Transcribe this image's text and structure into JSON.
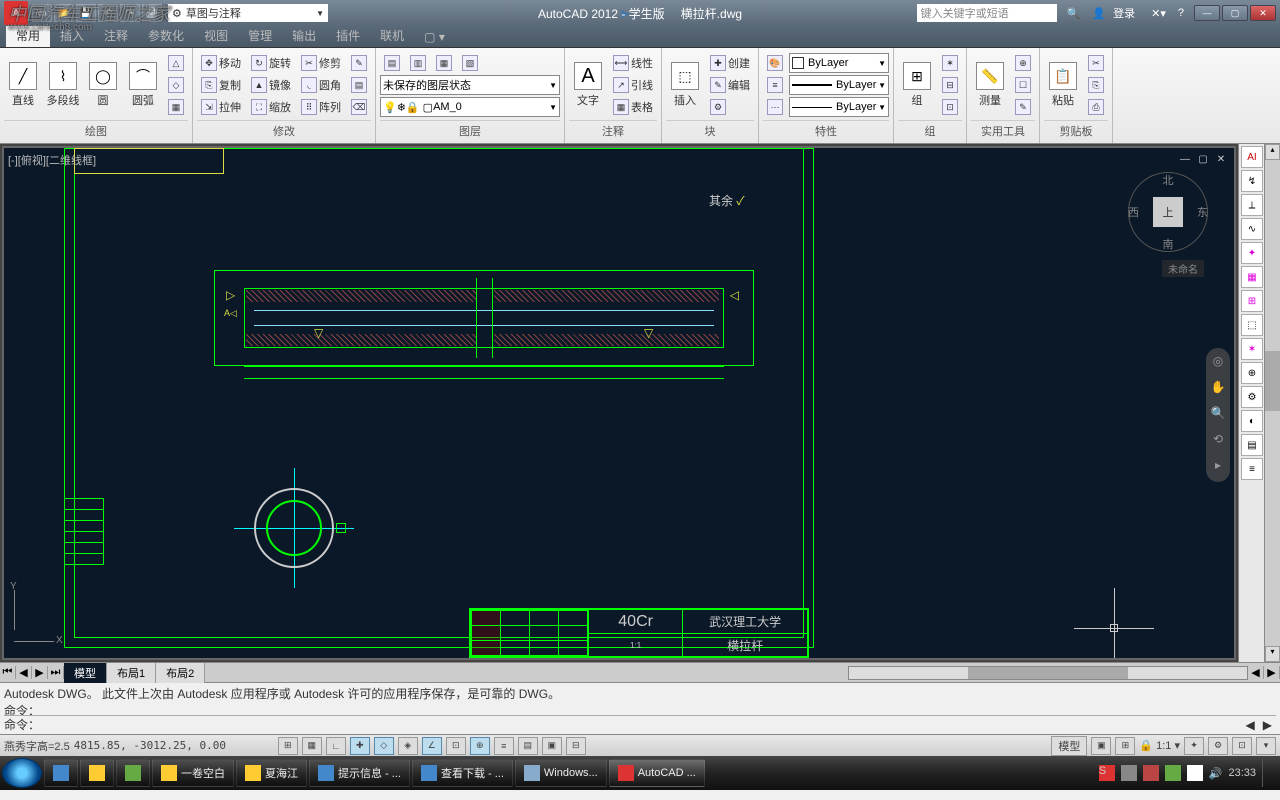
{
  "watermark": {
    "line1": "中国汽车工程师之家",
    "line2": "www.cartech8.com"
  },
  "titlebar": {
    "app": "AutoCAD 2012 - 学生版",
    "doc": "横拉杆.dwg",
    "workspace": "草图与注释",
    "search_placeholder": "键入关键字或短语",
    "login": "登录"
  },
  "tabs": [
    "常用",
    "插入",
    "注释",
    "参数化",
    "视图",
    "管理",
    "输出",
    "插件",
    "联机"
  ],
  "tabs_active": 0,
  "ribbon": {
    "draw": {
      "title": "绘图",
      "btns": [
        "直线",
        "多段线",
        "圆",
        "圆弧"
      ]
    },
    "modify": {
      "title": "修改",
      "rows": [
        [
          "移动",
          "旋转",
          "修剪"
        ],
        [
          "复制",
          "镜像",
          "圆角"
        ],
        [
          "拉伸",
          "缩放",
          "阵列"
        ]
      ]
    },
    "layers": {
      "title": "图层",
      "state": "未保存的图层状态",
      "current": "AM_0"
    },
    "annot": {
      "title": "注释",
      "text": "文字",
      "rows": [
        "线性",
        "引线",
        "表格"
      ]
    },
    "block": {
      "title": "块",
      "insert": "插入",
      "rows": [
        "创建",
        "编辑"
      ]
    },
    "props": {
      "title": "特性",
      "v1": "ByLayer",
      "v2": "ByLayer",
      "v3": "ByLayer"
    },
    "group": {
      "title": "组",
      "btn": "组"
    },
    "util": {
      "title": "实用工具",
      "btn": "测量"
    },
    "clip": {
      "title": "剪贴板",
      "btn": "粘贴"
    }
  },
  "viewport": {
    "label": "[-][俯视][二维线框]",
    "viewcube": {
      "face": "上",
      "n": "北",
      "s": "南",
      "e": "东",
      "w": "西"
    },
    "wcs": "未命名",
    "annotation_other": "其余",
    "ucs": {
      "x": "X",
      "y": "Y"
    }
  },
  "titleblock": {
    "material": "40Cr",
    "school": "武汉理工大学",
    "part": "横拉杆",
    "scale": "1:1"
  },
  "layout_tabs": [
    "模型",
    "布局1",
    "布局2"
  ],
  "layout_active": 0,
  "command": {
    "history": "Autodesk DWG。  此文件上次由 Autodesk 应用程序或 Autodesk 许可的应用程序保存，是可靠的 DWG。\n命令：",
    "prompt": "命令："
  },
  "status": {
    "text_height": "燕秀字高=2.5",
    "coords": "4815.85, -3012.25, 0.00",
    "space": "模型",
    "scale": "1:1"
  },
  "taskbar": {
    "items": [
      "一卷空白",
      "夏海江",
      "提示信息 - ...",
      "查看下载 - ...",
      "Windows...",
      "AutoCAD ..."
    ],
    "time": "23:33"
  }
}
